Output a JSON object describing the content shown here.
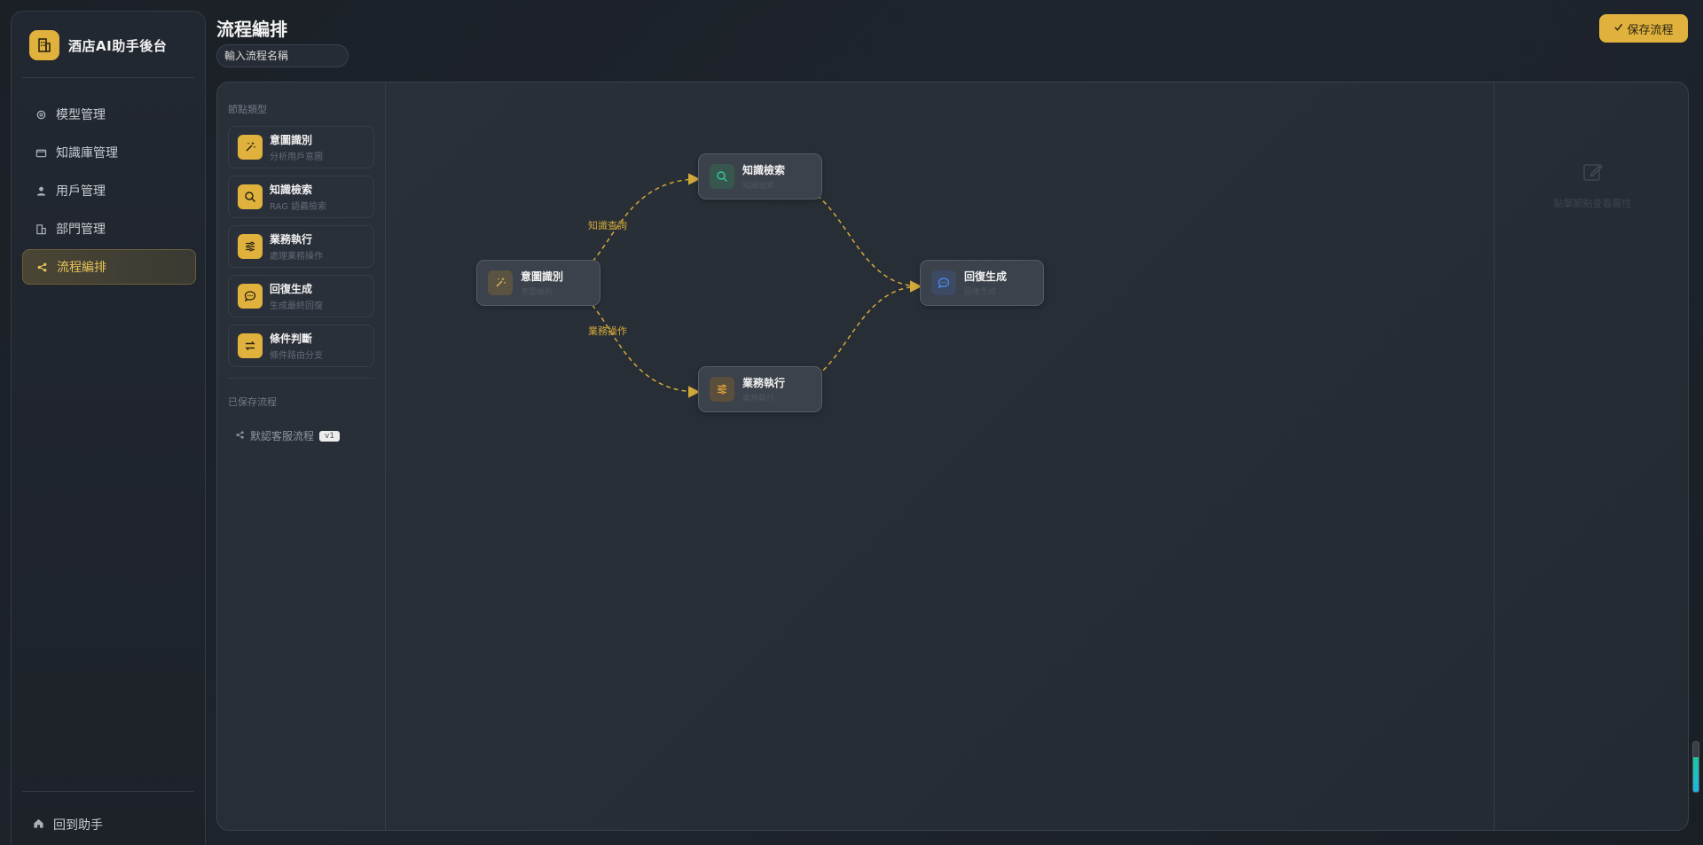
{
  "app": {
    "title": "酒店AI助手後台",
    "accent": "#e0b23d"
  },
  "sidebar": {
    "items": [
      {
        "label": "模型管理",
        "icon": "gear-icon",
        "active": false
      },
      {
        "label": "知識庫管理",
        "icon": "folder-icon",
        "active": false
      },
      {
        "label": "用戶管理",
        "icon": "user-icon",
        "active": false
      },
      {
        "label": "部門管理",
        "icon": "building-icon",
        "active": false
      },
      {
        "label": "流程編排",
        "icon": "share-icon",
        "active": true
      }
    ],
    "back_label": "回到助手"
  },
  "header": {
    "title": "流程編排",
    "flow_name_placeholder": "輸入流程名稱",
    "save_label": "保存流程"
  },
  "palette": {
    "node_types_title": "節點類型",
    "node_types": [
      {
        "title": "意圖識別",
        "desc": "分析用戶意圖",
        "icon": "magic-wand-icon"
      },
      {
        "title": "知識檢索",
        "desc": "RAG 語義檢索",
        "icon": "search-icon"
      },
      {
        "title": "業務執行",
        "desc": "處理業務操作",
        "icon": "sliders-icon"
      },
      {
        "title": "回復生成",
        "desc": "生成最終回復",
        "icon": "chat-bubble-icon"
      },
      {
        "title": "條件判斷",
        "desc": "條件路由分支",
        "icon": "swap-arrows-icon"
      }
    ],
    "saved_title": "已保存流程",
    "saved_flows": [
      {
        "name": "默認客服流程",
        "version": "v1"
      }
    ]
  },
  "canvas": {
    "nodes": {
      "intent": {
        "label": "意圖識別",
        "sub": "意圖識別",
        "icon": "magic-wand-icon"
      },
      "knowledge": {
        "label": "知識檢索",
        "sub": "知識檢索",
        "icon": "search-icon"
      },
      "business": {
        "label": "業務執行",
        "sub": "業務執行",
        "icon": "sliders-icon"
      },
      "reply": {
        "label": "回復生成",
        "sub": "回復生成",
        "icon": "chat-bubble-icon"
      }
    },
    "edges": {
      "intent_knowledge": "知識查詢",
      "intent_business": "業務操作"
    },
    "edge_color": "#d2a93a"
  },
  "properties": {
    "empty_text": "點擊節點查看屬性",
    "icon": "edit-icon"
  }
}
